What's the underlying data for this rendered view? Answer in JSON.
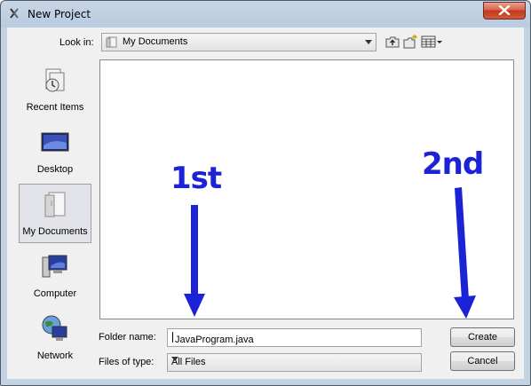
{
  "window": {
    "title": "New Project"
  },
  "toolbar": {
    "lookin_label": "Look in:",
    "lookin_value": "My Documents",
    "buttons": [
      "up-one-level-icon",
      "create-new-folder-icon",
      "view-menu-icon"
    ]
  },
  "places": [
    {
      "label": "Recent Items",
      "icon": "recent-items-icon",
      "selected": false
    },
    {
      "label": "Desktop",
      "icon": "desktop-icon",
      "selected": false
    },
    {
      "label": "My Documents",
      "icon": "my-documents-icon",
      "selected": true
    },
    {
      "label": "Computer",
      "icon": "computer-icon",
      "selected": false
    },
    {
      "label": "Network",
      "icon": "network-icon",
      "selected": false
    }
  ],
  "form": {
    "folder_name_label": "Folder name:",
    "folder_name_value": "JavaProgram.java",
    "files_of_type_label": "Files of type:",
    "files_of_type_value": "All Files"
  },
  "buttons": {
    "create": "Create",
    "cancel": "Cancel"
  },
  "annotations": {
    "first": "1st",
    "second": "2nd",
    "color": "#1c22d6"
  }
}
